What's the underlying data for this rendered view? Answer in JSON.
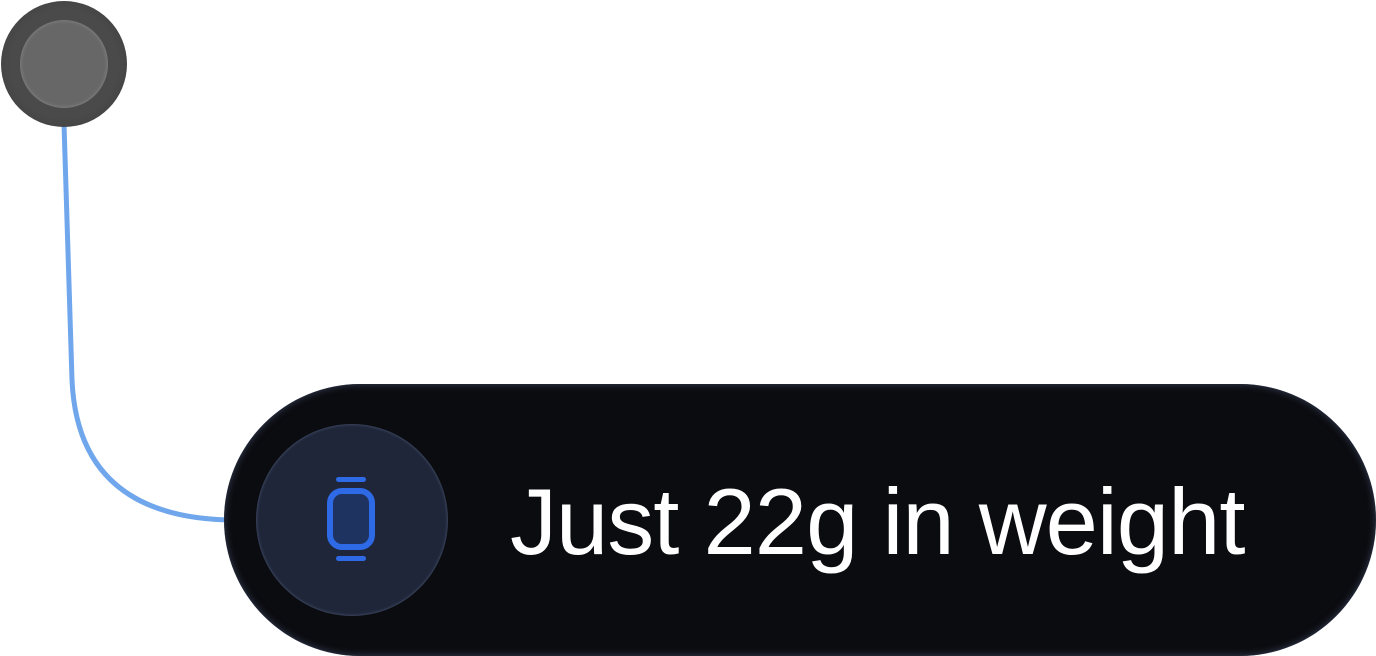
{
  "feature": {
    "label": "Just 22g in weight",
    "icon": "smartwatch-icon"
  },
  "colors": {
    "connector": "#6fa6ec",
    "icon_accent": "#2f6ae6",
    "pill_background": "#0b0c10",
    "icon_circle": "#1f2639",
    "anchor_dot": "#676767"
  }
}
